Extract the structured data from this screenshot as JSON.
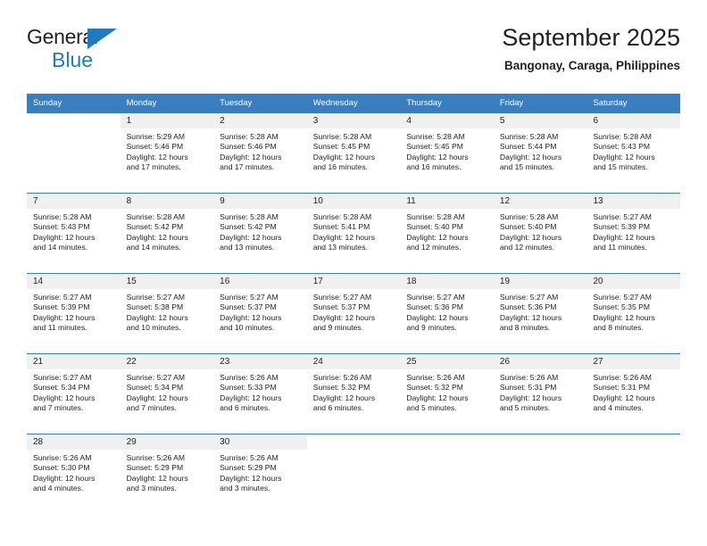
{
  "brand": {
    "name_part1": "General",
    "name_part2": "Blue",
    "triangle_icon": "triangle-right-icon",
    "accent_color": "#1f7ac0"
  },
  "header": {
    "title": "September 2025",
    "subtitle": "Bangonay, Caraga, Philippines"
  },
  "colors": {
    "header_band": "#3b7ebf",
    "daynum_band": "#f0f0f0",
    "text": "#231f20"
  },
  "weekdays": [
    "Sunday",
    "Monday",
    "Tuesday",
    "Wednesday",
    "Thursday",
    "Friday",
    "Saturday"
  ],
  "weeks": [
    [
      {
        "day": "",
        "sunrise": "",
        "sunset": "",
        "daylight_line1": "",
        "daylight_line2": "",
        "empty": true
      },
      {
        "day": "1",
        "sunrise": "Sunrise: 5:29 AM",
        "sunset": "Sunset: 5:46 PM",
        "daylight_line1": "Daylight: 12 hours",
        "daylight_line2": "and 17 minutes."
      },
      {
        "day": "2",
        "sunrise": "Sunrise: 5:28 AM",
        "sunset": "Sunset: 5:46 PM",
        "daylight_line1": "Daylight: 12 hours",
        "daylight_line2": "and 17 minutes."
      },
      {
        "day": "3",
        "sunrise": "Sunrise: 5:28 AM",
        "sunset": "Sunset: 5:45 PM",
        "daylight_line1": "Daylight: 12 hours",
        "daylight_line2": "and 16 minutes."
      },
      {
        "day": "4",
        "sunrise": "Sunrise: 5:28 AM",
        "sunset": "Sunset: 5:45 PM",
        "daylight_line1": "Daylight: 12 hours",
        "daylight_line2": "and 16 minutes."
      },
      {
        "day": "5",
        "sunrise": "Sunrise: 5:28 AM",
        "sunset": "Sunset: 5:44 PM",
        "daylight_line1": "Daylight: 12 hours",
        "daylight_line2": "and 15 minutes."
      },
      {
        "day": "6",
        "sunrise": "Sunrise: 5:28 AM",
        "sunset": "Sunset: 5:43 PM",
        "daylight_line1": "Daylight: 12 hours",
        "daylight_line2": "and 15 minutes."
      }
    ],
    [
      {
        "day": "7",
        "sunrise": "Sunrise: 5:28 AM",
        "sunset": "Sunset: 5:43 PM",
        "daylight_line1": "Daylight: 12 hours",
        "daylight_line2": "and 14 minutes."
      },
      {
        "day": "8",
        "sunrise": "Sunrise: 5:28 AM",
        "sunset": "Sunset: 5:42 PM",
        "daylight_line1": "Daylight: 12 hours",
        "daylight_line2": "and 14 minutes."
      },
      {
        "day": "9",
        "sunrise": "Sunrise: 5:28 AM",
        "sunset": "Sunset: 5:42 PM",
        "daylight_line1": "Daylight: 12 hours",
        "daylight_line2": "and 13 minutes."
      },
      {
        "day": "10",
        "sunrise": "Sunrise: 5:28 AM",
        "sunset": "Sunset: 5:41 PM",
        "daylight_line1": "Daylight: 12 hours",
        "daylight_line2": "and 13 minutes."
      },
      {
        "day": "11",
        "sunrise": "Sunrise: 5:28 AM",
        "sunset": "Sunset: 5:40 PM",
        "daylight_line1": "Daylight: 12 hours",
        "daylight_line2": "and 12 minutes."
      },
      {
        "day": "12",
        "sunrise": "Sunrise: 5:28 AM",
        "sunset": "Sunset: 5:40 PM",
        "daylight_line1": "Daylight: 12 hours",
        "daylight_line2": "and 12 minutes."
      },
      {
        "day": "13",
        "sunrise": "Sunrise: 5:27 AM",
        "sunset": "Sunset: 5:39 PM",
        "daylight_line1": "Daylight: 12 hours",
        "daylight_line2": "and 11 minutes."
      }
    ],
    [
      {
        "day": "14",
        "sunrise": "Sunrise: 5:27 AM",
        "sunset": "Sunset: 5:39 PM",
        "daylight_line1": "Daylight: 12 hours",
        "daylight_line2": "and 11 minutes."
      },
      {
        "day": "15",
        "sunrise": "Sunrise: 5:27 AM",
        "sunset": "Sunset: 5:38 PM",
        "daylight_line1": "Daylight: 12 hours",
        "daylight_line2": "and 10 minutes."
      },
      {
        "day": "16",
        "sunrise": "Sunrise: 5:27 AM",
        "sunset": "Sunset: 5:37 PM",
        "daylight_line1": "Daylight: 12 hours",
        "daylight_line2": "and 10 minutes."
      },
      {
        "day": "17",
        "sunrise": "Sunrise: 5:27 AM",
        "sunset": "Sunset: 5:37 PM",
        "daylight_line1": "Daylight: 12 hours",
        "daylight_line2": "and 9 minutes."
      },
      {
        "day": "18",
        "sunrise": "Sunrise: 5:27 AM",
        "sunset": "Sunset: 5:36 PM",
        "daylight_line1": "Daylight: 12 hours",
        "daylight_line2": "and 9 minutes."
      },
      {
        "day": "19",
        "sunrise": "Sunrise: 5:27 AM",
        "sunset": "Sunset: 5:36 PM",
        "daylight_line1": "Daylight: 12 hours",
        "daylight_line2": "and 8 minutes."
      },
      {
        "day": "20",
        "sunrise": "Sunrise: 5:27 AM",
        "sunset": "Sunset: 5:35 PM",
        "daylight_line1": "Daylight: 12 hours",
        "daylight_line2": "and 8 minutes."
      }
    ],
    [
      {
        "day": "21",
        "sunrise": "Sunrise: 5:27 AM",
        "sunset": "Sunset: 5:34 PM",
        "daylight_line1": "Daylight: 12 hours",
        "daylight_line2": "and 7 minutes."
      },
      {
        "day": "22",
        "sunrise": "Sunrise: 5:27 AM",
        "sunset": "Sunset: 5:34 PM",
        "daylight_line1": "Daylight: 12 hours",
        "daylight_line2": "and 7 minutes."
      },
      {
        "day": "23",
        "sunrise": "Sunrise: 5:26 AM",
        "sunset": "Sunset: 5:33 PM",
        "daylight_line1": "Daylight: 12 hours",
        "daylight_line2": "and 6 minutes."
      },
      {
        "day": "24",
        "sunrise": "Sunrise: 5:26 AM",
        "sunset": "Sunset: 5:32 PM",
        "daylight_line1": "Daylight: 12 hours",
        "daylight_line2": "and 6 minutes."
      },
      {
        "day": "25",
        "sunrise": "Sunrise: 5:26 AM",
        "sunset": "Sunset: 5:32 PM",
        "daylight_line1": "Daylight: 12 hours",
        "daylight_line2": "and 5 minutes."
      },
      {
        "day": "26",
        "sunrise": "Sunrise: 5:26 AM",
        "sunset": "Sunset: 5:31 PM",
        "daylight_line1": "Daylight: 12 hours",
        "daylight_line2": "and 5 minutes."
      },
      {
        "day": "27",
        "sunrise": "Sunrise: 5:26 AM",
        "sunset": "Sunset: 5:31 PM",
        "daylight_line1": "Daylight: 12 hours",
        "daylight_line2": "and 4 minutes."
      }
    ],
    [
      {
        "day": "28",
        "sunrise": "Sunrise: 5:26 AM",
        "sunset": "Sunset: 5:30 PM",
        "daylight_line1": "Daylight: 12 hours",
        "daylight_line2": "and 4 minutes."
      },
      {
        "day": "29",
        "sunrise": "Sunrise: 5:26 AM",
        "sunset": "Sunset: 5:29 PM",
        "daylight_line1": "Daylight: 12 hours",
        "daylight_line2": "and 3 minutes."
      },
      {
        "day": "30",
        "sunrise": "Sunrise: 5:26 AM",
        "sunset": "Sunset: 5:29 PM",
        "daylight_line1": "Daylight: 12 hours",
        "daylight_line2": "and 3 minutes."
      },
      {
        "day": "",
        "sunrise": "",
        "sunset": "",
        "daylight_line1": "",
        "daylight_line2": "",
        "empty": true
      },
      {
        "day": "",
        "sunrise": "",
        "sunset": "",
        "daylight_line1": "",
        "daylight_line2": "",
        "empty": true
      },
      {
        "day": "",
        "sunrise": "",
        "sunset": "",
        "daylight_line1": "",
        "daylight_line2": "",
        "empty": true
      },
      {
        "day": "",
        "sunrise": "",
        "sunset": "",
        "daylight_line1": "",
        "daylight_line2": "",
        "empty": true
      }
    ]
  ]
}
